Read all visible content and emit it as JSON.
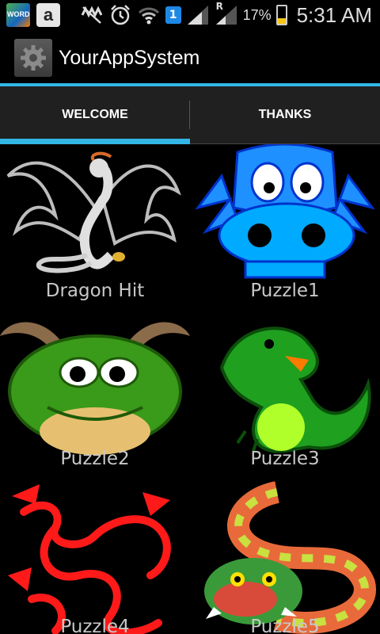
{
  "status_bar": {
    "notification_icons": [
      "word-game-icon",
      "amazon-icon",
      "sync-off-icon",
      "alarm-icon",
      "wifi-icon",
      "sim-1-icon",
      "signal-icon",
      "roaming-signal-icon",
      "battery-icon"
    ],
    "word_badge": "WORD",
    "amazon_letter": "a",
    "sim_number": "1",
    "roaming_letter": "R",
    "battery_percent": "17%",
    "battery_level": 0.17,
    "time": "5:31 AM"
  },
  "action_bar": {
    "title": "YourAppSystem",
    "accent_color": "#33b5e5"
  },
  "tabs": [
    {
      "label": "WELCOME",
      "selected": true
    },
    {
      "label": "THANKS",
      "selected": false
    }
  ],
  "games": [
    {
      "label": "Dragon Hit",
      "art": "white-dragon"
    },
    {
      "label": "Puzzle1",
      "art": "blue-dragon"
    },
    {
      "label": "Puzzle2",
      "art": "green-horned-dragon"
    },
    {
      "label": "Puzzle3",
      "art": "green-dinosaur"
    },
    {
      "label": "Puzzle4",
      "art": "red-chinese-dragon"
    },
    {
      "label": "Puzzle5",
      "art": "colorful-serpent"
    }
  ]
}
